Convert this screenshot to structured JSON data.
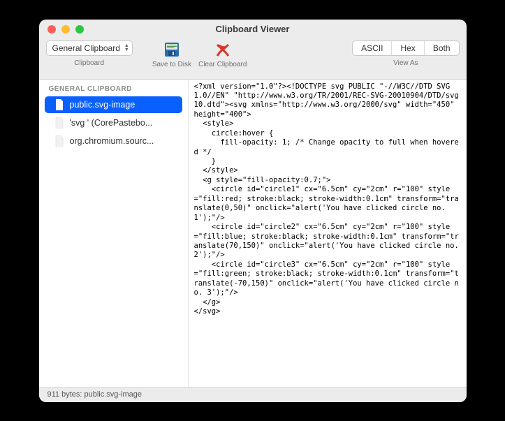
{
  "window": {
    "title": "Clipboard Viewer"
  },
  "toolbar": {
    "clipboard_select": "General Clipboard",
    "clipboard_label": "Clipboard",
    "save_label": "Save to Disk",
    "clear_label": "Clear Clipboard",
    "viewas_label": "View As",
    "seg": {
      "ascii": "ASCII",
      "hex": "Hex",
      "both": "Both"
    }
  },
  "sidebar": {
    "header": "GENERAL CLIPBOARD",
    "items": [
      {
        "label": "public.svg-image"
      },
      {
        "label": "'svg ' (CorePastebo..."
      },
      {
        "label": "org.chromium.sourc..."
      }
    ]
  },
  "content": "<?xml version=\"1.0\"?><!DOCTYPE svg PUBLIC \"-//W3C//DTD SVG 1.0//EN\" \"http://www.w3.org/TR/2001/REC-SVG-20010904/DTD/svg10.dtd\"><svg xmlns=\"http://www.w3.org/2000/svg\" width=\"450\" height=\"400\">\n  <style>\n    circle:hover {\n      fill-opacity: 1; /* Change opacity to full when hovered */\n    }\n  </style>\n  <g style=\"fill-opacity:0.7;\">\n    <circle id=\"circle1\" cx=\"6.5cm\" cy=\"2cm\" r=\"100\" style=\"fill:red; stroke:black; stroke-width:0.1cm\" transform=\"translate(0,50)\" onclick=\"alert('You have clicked circle no. 1');\"/>\n    <circle id=\"circle2\" cx=\"6.5cm\" cy=\"2cm\" r=\"100\" style=\"fill:blue; stroke:black; stroke-width:0.1cm\" transform=\"translate(70,150)\" onclick=\"alert('You have clicked circle no. 2');\"/>\n    <circle id=\"circle3\" cx=\"6.5cm\" cy=\"2cm\" r=\"100\" style=\"fill:green; stroke:black; stroke-width:0.1cm\" transform=\"translate(-70,150)\" onclick=\"alert('You have clicked circle no. 3');\"/>\n  </g>\n</svg>",
  "status": "911 bytes: public.svg-image"
}
